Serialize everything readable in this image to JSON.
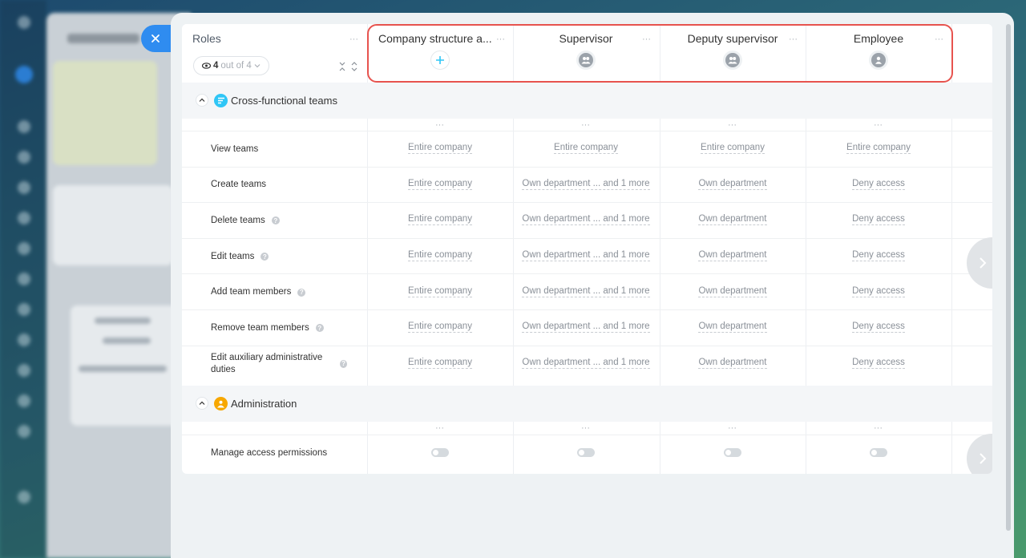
{
  "table": {
    "roles_label": "Roles",
    "counter": {
      "count": "4",
      "suffix": "out of 4"
    },
    "columns": [
      {
        "title": "Company structure a...",
        "icon": "plus-icon"
      },
      {
        "title": "Supervisor",
        "icon": "group-icon"
      },
      {
        "title": "Deputy supervisor",
        "icon": "group-icon"
      },
      {
        "title": "Employee",
        "icon": "user-icon"
      }
    ]
  },
  "sections": [
    {
      "title": "Cross-functional teams",
      "icon": "teams-icon",
      "icon_color": "#2fc6f6",
      "rows": [
        {
          "label": "View teams",
          "help": false,
          "values": [
            "Entire company",
            "Entire company",
            "Entire company",
            "Entire company"
          ]
        },
        {
          "label": "Create teams",
          "help": false,
          "values": [
            "Entire company",
            "Own department ... and 1 more",
            "Own department",
            "Deny access"
          ]
        },
        {
          "label": "Delete teams",
          "help": true,
          "values": [
            "Entire company",
            "Own department ... and 1 more",
            "Own department",
            "Deny access"
          ]
        },
        {
          "label": "Edit teams",
          "help": true,
          "values": [
            "Entire company",
            "Own department ... and 1 more",
            "Own department",
            "Deny access"
          ]
        },
        {
          "label": "Add team members",
          "help": true,
          "values": [
            "Entire company",
            "Own department ... and 1 more",
            "Own department",
            "Deny access"
          ]
        },
        {
          "label": "Remove team members",
          "help": true,
          "values": [
            "Entire company",
            "Own department ... and 1 more",
            "Own department",
            "Deny access"
          ]
        },
        {
          "label": "Edit auxiliary administrative duties",
          "help": true,
          "values": [
            "Entire company",
            "Own department ... and 1 more",
            "Own department",
            "Deny access"
          ]
        }
      ]
    },
    {
      "title": "Administration",
      "icon": "administration-icon",
      "icon_color": "#f7a700",
      "rows": [
        {
          "label": "Manage access permissions",
          "help": false,
          "toggles": [
            false,
            false,
            false,
            false
          ]
        }
      ]
    }
  ],
  "highlight_color": "#e7534e",
  "accent_color": "#2f8cf0"
}
